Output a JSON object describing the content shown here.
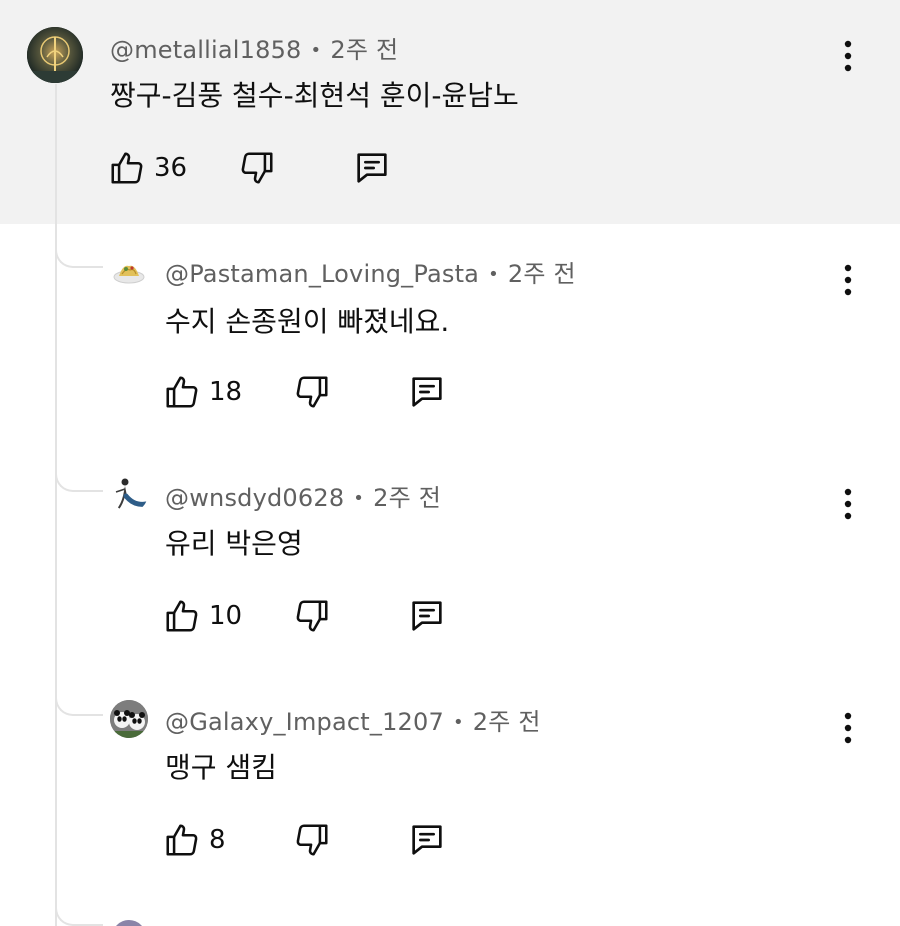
{
  "comments": [
    {
      "author": "@metallial1858",
      "separator": "•",
      "time": "2주 전",
      "text": "짱구-김풍 철수-최현석 훈이-윤남노",
      "likes": "36",
      "avatar_icon": "golden-tree-emblem-avatar",
      "highlighted": true
    },
    {
      "author": "@Pastaman_Loving_Pasta",
      "separator": "•",
      "time": "2주 전",
      "text": "수지 손종원이 빠졌네요.",
      "likes": "18",
      "avatar_icon": "pasta-plate-avatar"
    },
    {
      "author": "@wnsdyd0628",
      "separator": "•",
      "time": "2주 전",
      "text": "유리 박은영",
      "likes": "10",
      "avatar_icon": "dancer-figure-avatar"
    },
    {
      "author": "@Galaxy_Impact_1207",
      "separator": "•",
      "time": "2주 전",
      "text": "맹구 샘킴",
      "likes": "8",
      "avatar_icon": "panda-avatar"
    }
  ],
  "colors": {
    "highlight_background": "#f2f2f2",
    "meta_text": "#606060",
    "thread_line": "#e3e3e3"
  }
}
